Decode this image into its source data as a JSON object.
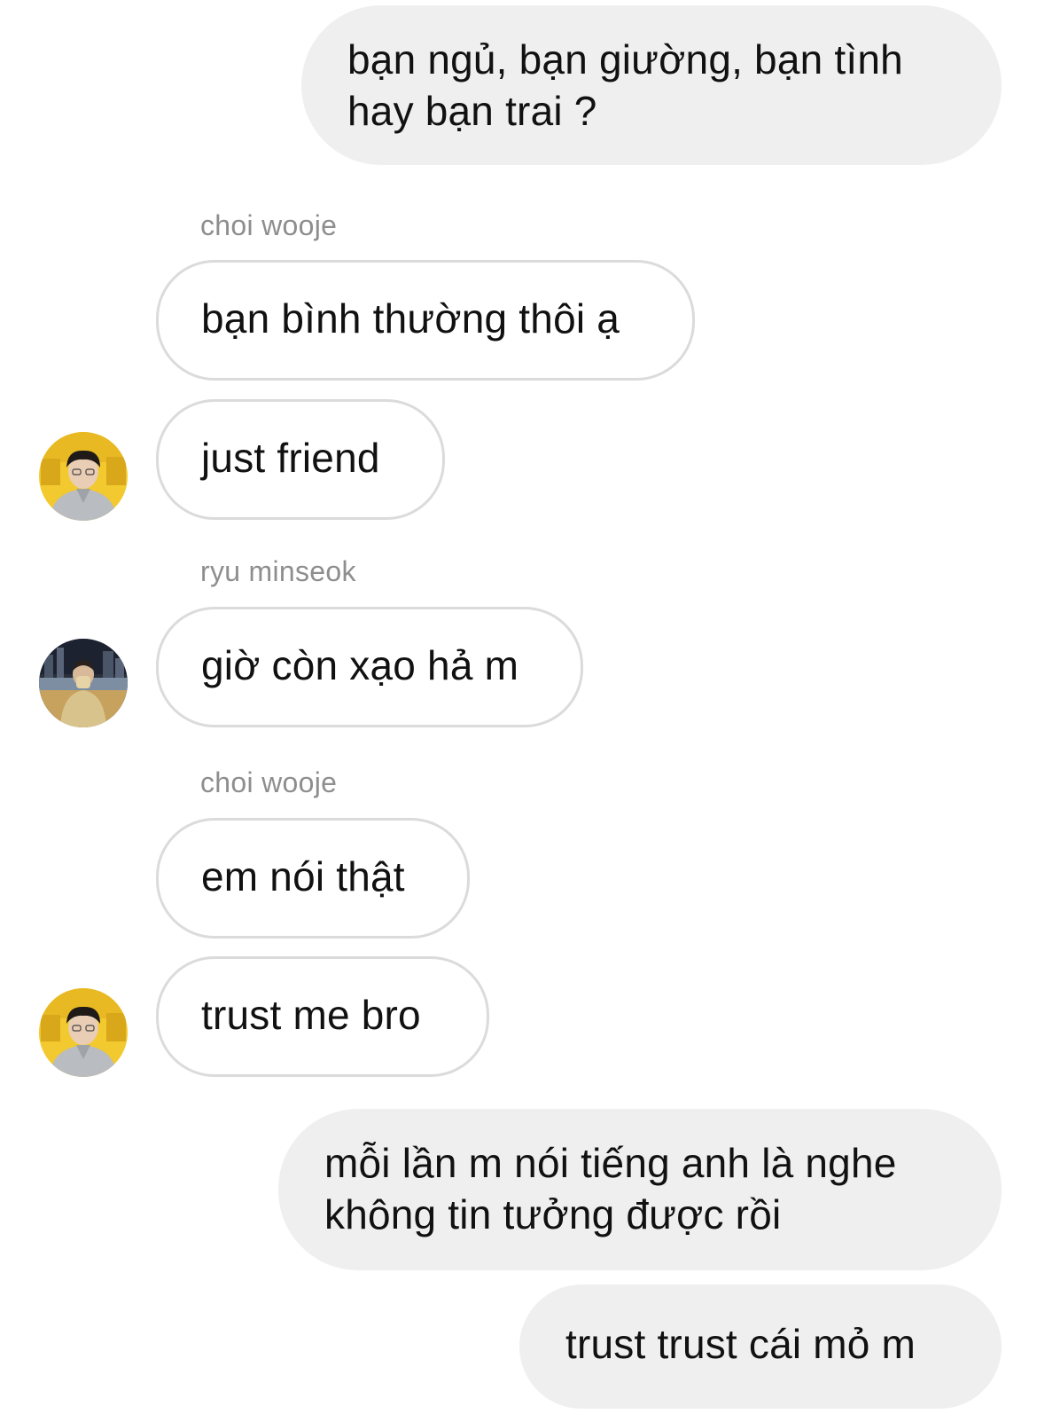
{
  "conversation": {
    "messages": [
      {
        "text": "bạn ngủ, bạn giường, bạn tình hay bạn trai ?"
      },
      {
        "text": "bạn bình thường thôi ạ"
      },
      {
        "text": "just friend"
      },
      {
        "text": "giờ còn xạo hả m"
      },
      {
        "text": "em nói thật"
      },
      {
        "text": "trust me bro"
      },
      {
        "text": "mỗi lần m nói tiếng anh là nghe không tin tưởng được rồi"
      },
      {
        "text": "trust trust cái mỏ m"
      }
    ],
    "senders": {
      "first": "choi wooje",
      "second": "ryu minseok",
      "third": "choi wooje"
    }
  },
  "avatars": {
    "wooje_icon": "avatar-photo-yellow-background",
    "minseok_icon": "avatar-photo-city-night"
  },
  "colors": {
    "outgoing_bubble": "#efefef",
    "incoming_border": "#dbdbdb",
    "sender_name": "#8e8e8e"
  }
}
